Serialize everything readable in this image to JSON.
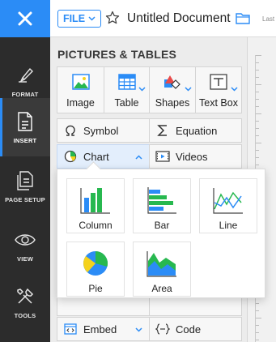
{
  "rail": {
    "items": [
      {
        "label": "FORMAT",
        "icon": "format-brush-icon"
      },
      {
        "label": "INSERT",
        "icon": "insert-doc-icon",
        "active": true
      },
      {
        "label": "PAGE SETUP",
        "icon": "page-setup-icon"
      },
      {
        "label": "VIEW",
        "icon": "eye-icon"
      },
      {
        "label": "TOOLS",
        "icon": "tools-icon"
      }
    ]
  },
  "topbar": {
    "file_label": "FILE",
    "doc_title": "Untitled Document",
    "last_edit_label": "Last"
  },
  "panel": {
    "title": "PICTURES & TABLES",
    "big_buttons": [
      {
        "label": "Image",
        "icon": "image-icon"
      },
      {
        "label": "Table",
        "icon": "table-icon"
      },
      {
        "label": "Shapes",
        "icon": "shapes-icon"
      },
      {
        "label": "Text Box",
        "icon": "textbox-icon"
      }
    ],
    "rows": [
      [
        {
          "label": "Symbol",
          "icon": "omega-icon"
        },
        {
          "label": "Equation",
          "icon": "sigma-icon"
        }
      ],
      [
        {
          "label": "Chart",
          "icon": "chart-pie-icon"
        },
        {
          "label": "Videos",
          "icon": "video-icon"
        }
      ],
      [
        {
          "label": "Embed",
          "icon": "embed-icon"
        },
        {
          "label": "Code",
          "icon": "code-icon"
        }
      ]
    ]
  },
  "chart_menu": {
    "options": [
      {
        "label": "Column",
        "icon": "column-chart-icon"
      },
      {
        "label": "Bar",
        "icon": "bar-chart-icon"
      },
      {
        "label": "Line",
        "icon": "line-chart-icon"
      },
      {
        "label": "Pie",
        "icon": "pie-chart-icon"
      },
      {
        "label": "Area",
        "icon": "area-chart-icon"
      }
    ]
  },
  "colors": {
    "accent": "#2b8cf6",
    "rail_bg": "#2c2c2c",
    "panel_bg": "#ececec",
    "chart_green": "#27b84f",
    "chart_blue": "#2b8cf6",
    "chart_yellow": "#f5d21c"
  }
}
